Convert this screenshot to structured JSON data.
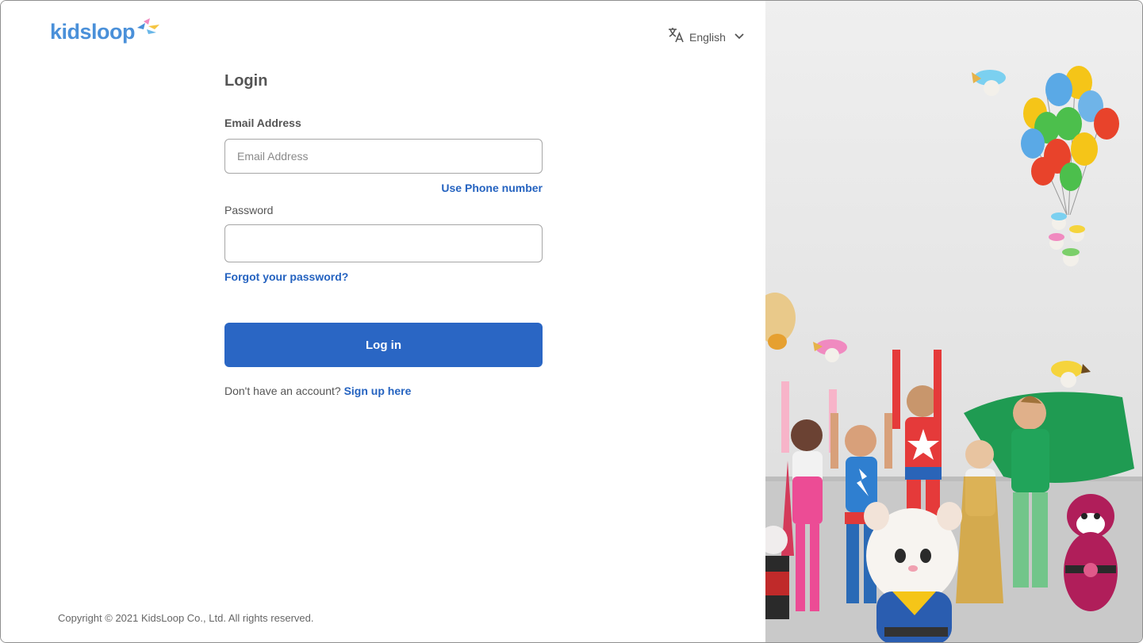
{
  "brand": {
    "logo_text": "kidsloop"
  },
  "language": {
    "icon": "translate-icon",
    "label": "English",
    "chevron": "chevron-down-icon"
  },
  "form": {
    "title": "Login",
    "email_label": "Email Address",
    "email_placeholder": "Email Address",
    "email_value": "",
    "use_phone_link": "Use Phone number",
    "password_label": "Password",
    "password_value": "",
    "forgot_link": "Forgot your password?",
    "login_button": "Log in",
    "signup_prompt": "Don't have an account?",
    "signup_link": "Sign up here"
  },
  "footer": {
    "copyright": "Copyright © 2021 KidsLoop Co., Ltd. All rights reserved."
  },
  "colors": {
    "primary": "#2a66c4",
    "link": "#2563c0",
    "logo": "#4a90d9"
  }
}
